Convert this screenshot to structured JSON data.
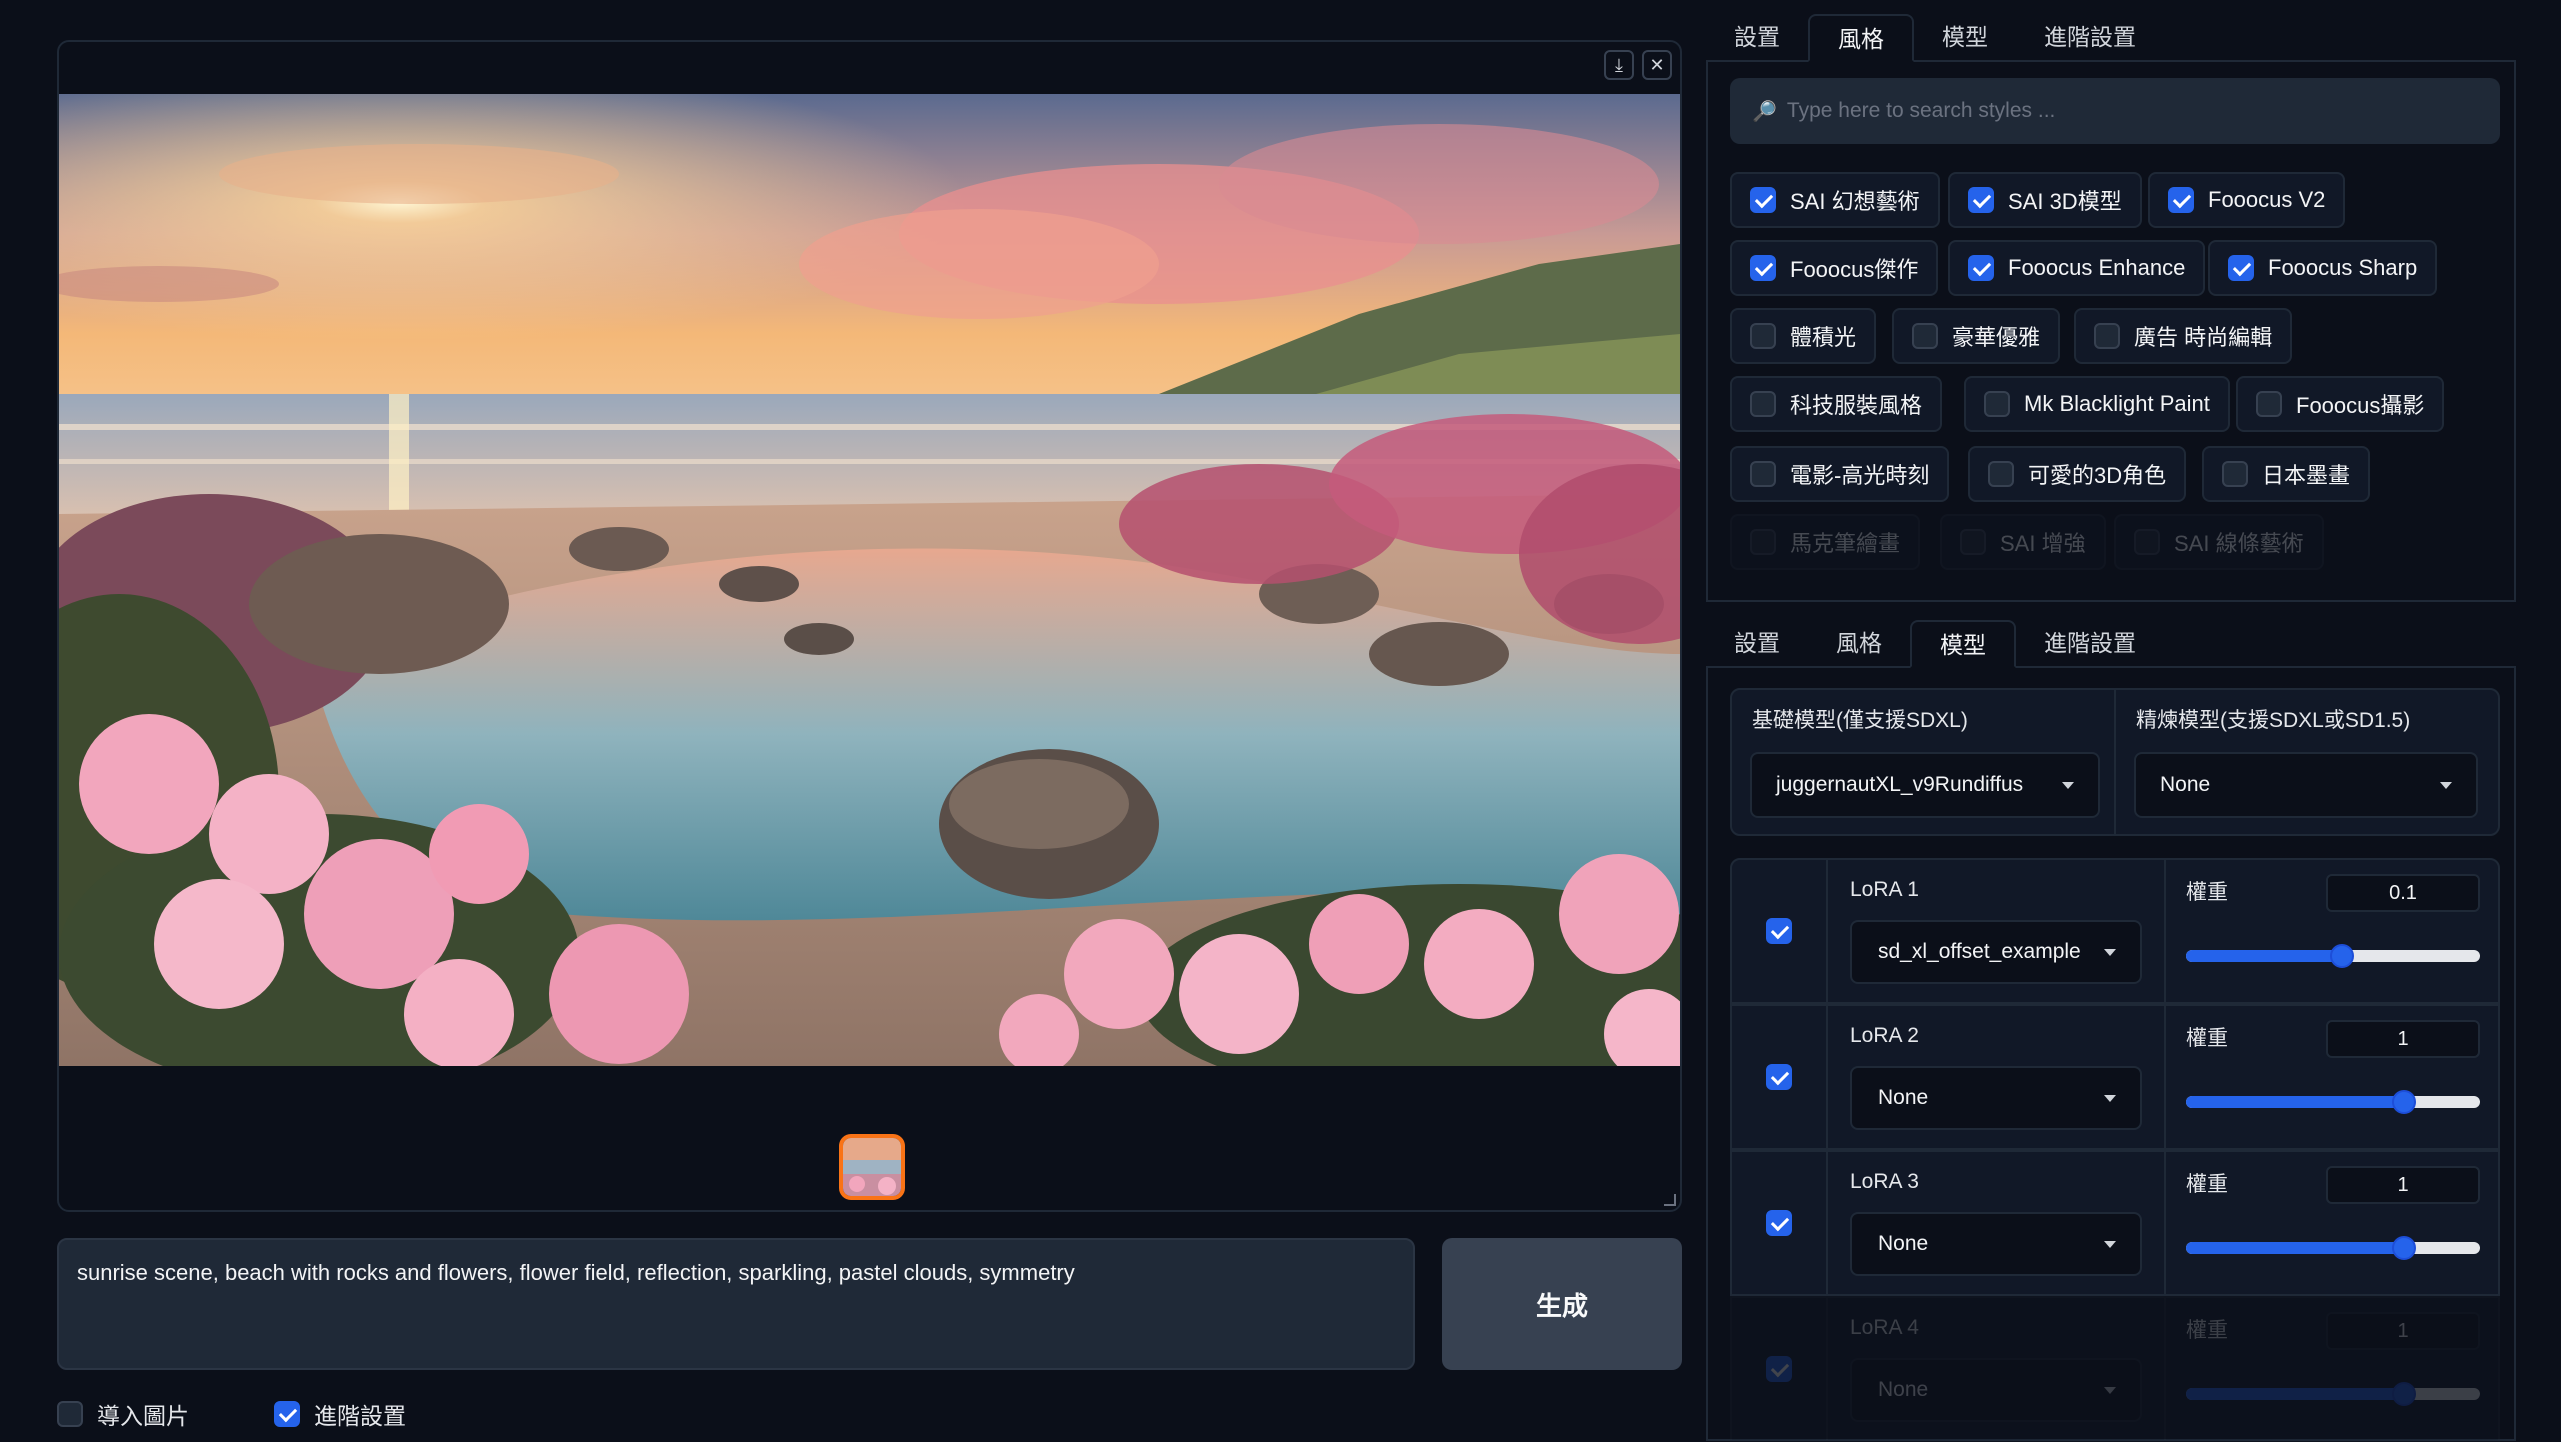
{
  "gallery": {
    "download_icon": "download-icon",
    "close_icon": "close-icon"
  },
  "prompt": {
    "text": "sunrise scene, beach with rocks and flowers, flower field, reflection, sparkling, pastel clouds, symmetry"
  },
  "generate_button": "生成",
  "bottom_options": [
    {
      "label": "導入圖片",
      "checked": false
    },
    {
      "label": "進階設置",
      "checked": true
    }
  ],
  "tabs_top": [
    "設置",
    "風格",
    "模型",
    "進階設置"
  ],
  "tabs_top_active": "風格",
  "style_search": {
    "placeholder": "Type here to search styles ...",
    "icon": "search-icon"
  },
  "styles": [
    {
      "label": "SAI 幻想藝術",
      "checked": true
    },
    {
      "label": "SAI 3D模型",
      "checked": true
    },
    {
      "label": "Fooocus V2",
      "checked": true
    },
    {
      "label": "Fooocus傑作",
      "checked": true
    },
    {
      "label": "Fooocus Enhance",
      "checked": true
    },
    {
      "label": "Fooocus Sharp",
      "checked": true
    },
    {
      "label": "體積光",
      "checked": false
    },
    {
      "label": "豪華優雅",
      "checked": false
    },
    {
      "label": "廣告 時尚編輯",
      "checked": false
    },
    {
      "label": "科技服裝風格",
      "checked": false
    },
    {
      "label": "Mk Blacklight Paint",
      "checked": false
    },
    {
      "label": "Fooocus攝影",
      "checked": false
    },
    {
      "label": "電影-高光時刻",
      "checked": false
    },
    {
      "label": "可愛的3D角色",
      "checked": false
    },
    {
      "label": "日本墨畫",
      "checked": false
    },
    {
      "label": "馬克筆繪畫",
      "checked": false
    },
    {
      "label": "SAI 增強",
      "checked": false
    },
    {
      "label": "SAI 線條藝術",
      "checked": false
    }
  ],
  "tabs_model": [
    "設置",
    "風格",
    "模型",
    "進階設置"
  ],
  "tabs_model_active": "模型",
  "base_model": {
    "label": "基礎模型(僅支援SDXL)",
    "value": "juggernautXL_v9Rundiffus"
  },
  "refiner_model": {
    "label": "精煉模型(支援SDXL或SD1.5)",
    "value": "None"
  },
  "loras": [
    {
      "name": "LoRA 1",
      "checked": true,
      "model": "sd_xl_offset_example",
      "weight_label": "權重",
      "weight": "0.1",
      "level": 0.53
    },
    {
      "name": "LoRA 2",
      "checked": true,
      "model": "None",
      "weight_label": "權重",
      "weight": "1",
      "level": 0.74
    },
    {
      "name": "LoRA 3",
      "checked": true,
      "model": "None",
      "weight_label": "權重",
      "weight": "1",
      "level": 0.74
    },
    {
      "name": "LoRA 4",
      "checked": true,
      "model": "None",
      "weight_label": "權重",
      "weight": "1",
      "level": 0.74
    }
  ],
  "colors": {
    "accent": "#2563eb",
    "thumb_border": "#f97316",
    "bg": "#0b0f19"
  }
}
